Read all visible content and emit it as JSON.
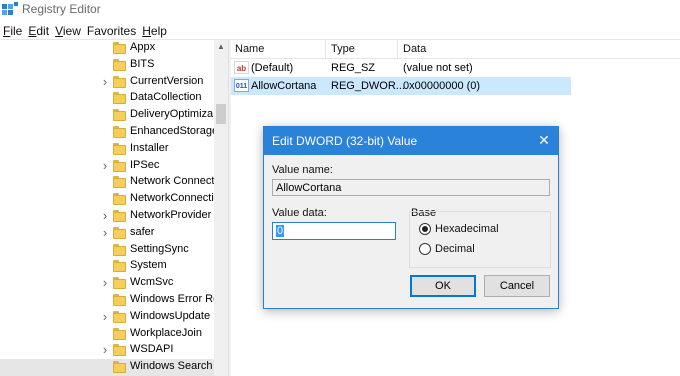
{
  "window": {
    "title": "Registry Editor"
  },
  "menu": [
    {
      "accel": "F",
      "rest": "ile"
    },
    {
      "accel": "E",
      "rest": "dit"
    },
    {
      "accel": "V",
      "rest": "iew"
    },
    {
      "accel": "",
      "rest": "Favorites"
    },
    {
      "accel": "H",
      "rest": "elp"
    }
  ],
  "tree": {
    "items": [
      {
        "label": "Appx",
        "expandable": false
      },
      {
        "label": "BITS",
        "expandable": false
      },
      {
        "label": "CurrentVersion",
        "expandable": true
      },
      {
        "label": "DataCollection",
        "expandable": false
      },
      {
        "label": "DeliveryOptimiza",
        "expandable": false
      },
      {
        "label": "EnhancedStorage",
        "expandable": false
      },
      {
        "label": "Installer",
        "expandable": false
      },
      {
        "label": "IPSec",
        "expandable": true
      },
      {
        "label": "Network Connect",
        "expandable": false
      },
      {
        "label": "NetworkConnecti",
        "expandable": false
      },
      {
        "label": "NetworkProvider",
        "expandable": true
      },
      {
        "label": "safer",
        "expandable": true
      },
      {
        "label": "SettingSync",
        "expandable": false
      },
      {
        "label": "System",
        "expandable": false
      },
      {
        "label": "WcmSvc",
        "expandable": true
      },
      {
        "label": "Windows Error Re",
        "expandable": false
      },
      {
        "label": "WindowsUpdate",
        "expandable": true
      },
      {
        "label": "WorkplaceJoin",
        "expandable": false
      },
      {
        "label": "WSDAPI",
        "expandable": true
      },
      {
        "label": "Windows Search",
        "expandable": false,
        "selected": true
      }
    ]
  },
  "list": {
    "columns": {
      "name": "Name",
      "type": "Type",
      "data": "Data"
    },
    "rows": [
      {
        "icon": "ab",
        "name": "(Default)",
        "type": "REG_SZ",
        "data": "(value not set)"
      },
      {
        "icon": "011",
        "name": "AllowCortana",
        "type": "REG_DWOR...",
        "data": "0x00000000 (0)",
        "selected": true
      }
    ]
  },
  "dialog": {
    "title": "Edit DWORD (32-bit) Value",
    "value_name_label": "Value name:",
    "value_name": "AllowCortana",
    "value_data_label": "Value data:",
    "value_data": "0",
    "base_label": "Base",
    "hex_label": "Hexadecimal",
    "dec_label": "Decimal",
    "base_selected": "Hexadecimal",
    "ok_label": "OK",
    "cancel_label": "Cancel",
    "close_glyph": "✕"
  },
  "colors": {
    "dialog_titlebar": "#2b82d9",
    "selection": "#cce8ff",
    "folder": "#f5cf5a"
  }
}
